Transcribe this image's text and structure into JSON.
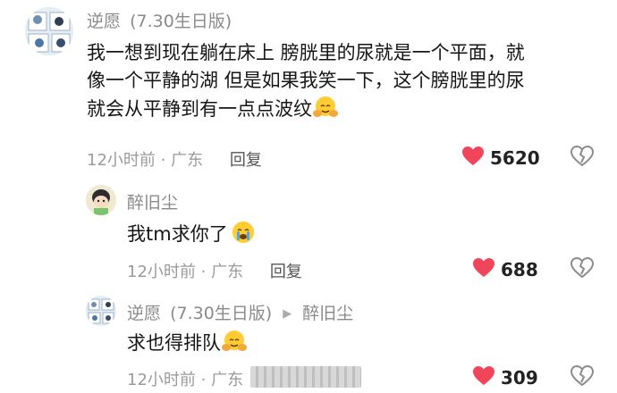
{
  "comments": [
    {
      "author": "逆愿",
      "author_tag": "(7.30生日版)",
      "text_line1": "我一想到现在躺在床上 膀胱里的尿就是一个平面，就",
      "text_line2": "像一个平静的湖 但是如果我笑一下，这个膀胱里的尿",
      "text_line3": "就会从平静到有一点点波纹",
      "time": "12小时前",
      "location": "广东",
      "reply_label": "回复",
      "likes": "5620"
    },
    {
      "author": "醉旧尘",
      "text": "我tm求你了",
      "time": "12小时前",
      "location": "广东",
      "reply_label": "回复",
      "likes": "688"
    },
    {
      "author": "逆愿",
      "author_tag": "(7.30生日版)",
      "reply_to": "醉旧尘",
      "text": "求也得排队",
      "time": "12小时前",
      "location": "广东",
      "likes": "309"
    }
  ],
  "colors": {
    "heart": "#f0455a",
    "meta": "#9b9b9b",
    "name": "#8a8a8a"
  },
  "icons": {
    "like": "heart-icon",
    "dislike": "broken-heart-icon",
    "emoji_hug": "hugging-emoji",
    "emoji_cry": "crying-emoji"
  }
}
